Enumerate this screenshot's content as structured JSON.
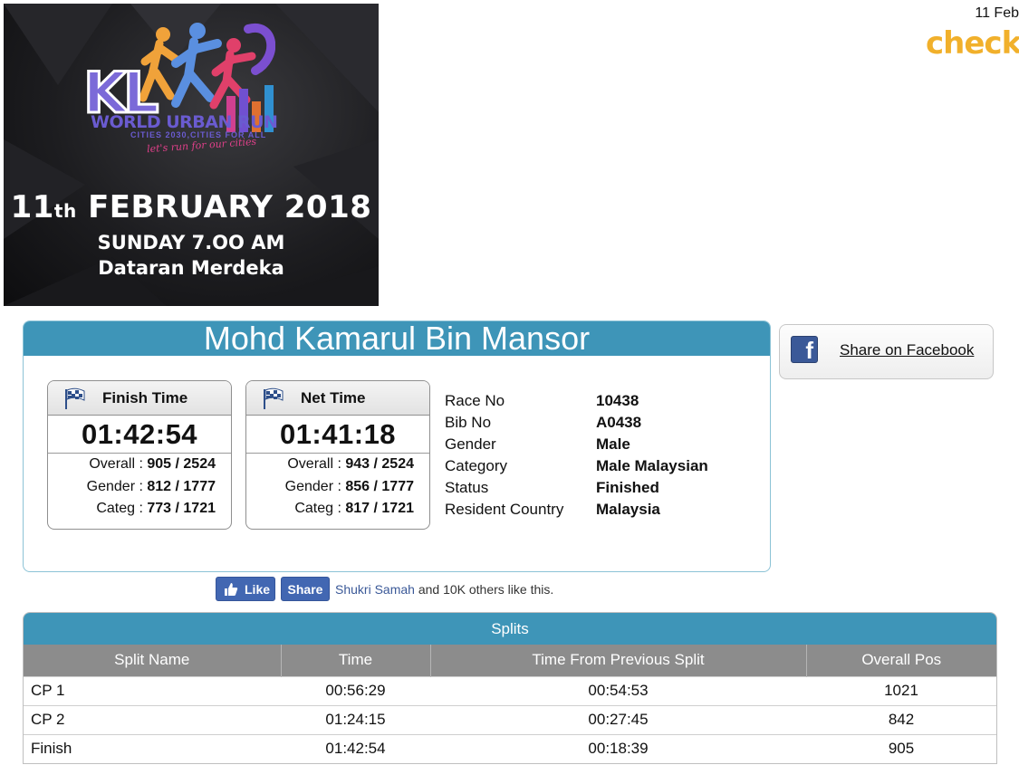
{
  "header": {
    "date": "11 Feb",
    "logo_text": "check",
    "brand_color": "#f1b02b"
  },
  "banner": {
    "logo_kl": "KL",
    "logo_title": "WORLD URBAN RUN",
    "logo_sub": "CITIES 2030,CITIES FOR ALL",
    "tagline": "let's run for our cities",
    "date_day": "11",
    "date_suffix": "th",
    "date_rest": "FEBRUARY 2018",
    "time": "SUNDAY 7.OO AM",
    "venue": "Dataran Merdeka"
  },
  "runner": {
    "name": "Mohd Kamarul Bin Mansor",
    "finish": {
      "title": "Finish Time",
      "time": "01:42:54",
      "overall_label": "Overall :",
      "overall": "905 / 2524",
      "gender_label": "Gender :",
      "gender": "812 / 1777",
      "categ_label": "Categ :",
      "categ": "773 / 1721"
    },
    "net": {
      "title": "Net Time",
      "time": "01:41:18",
      "overall_label": "Overall :",
      "overall": "943 / 2524",
      "gender_label": "Gender :",
      "gender": "856 / 1777",
      "categ_label": "Categ :",
      "categ": "817 / 1721"
    },
    "info": [
      {
        "label": "Race No",
        "value": "10438"
      },
      {
        "label": "Bib No",
        "value": "A0438"
      },
      {
        "label": "Gender",
        "value": "Male"
      },
      {
        "label": "Category",
        "value": "Male Malaysian"
      },
      {
        "label": "Status",
        "value": "Finished"
      },
      {
        "label": "Resident Country",
        "value": "Malaysia"
      }
    ],
    "accent_color": "#3e95b8"
  },
  "facebook": {
    "share_label": "Share on Facebook",
    "icon": "facebook-icon",
    "like_label": "Like",
    "share_btn": "Share",
    "friend": "Shukri Samah",
    "like_suffix": "and 10K others like this."
  },
  "splits": {
    "title": "Splits",
    "columns": [
      "Split Name",
      "Time",
      "Time From Previous Split",
      "Overall Pos"
    ],
    "rows": [
      [
        "CP 1",
        "00:56:29",
        "00:54:53",
        "1021"
      ],
      [
        "CP 2",
        "01:24:15",
        "00:27:45",
        "842"
      ],
      [
        "Finish",
        "01:42:54",
        "00:18:39",
        "905"
      ]
    ]
  }
}
